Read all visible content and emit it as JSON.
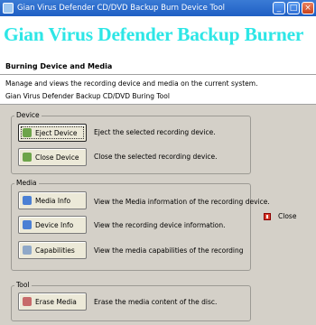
{
  "window": {
    "title": "Gian Virus Defender CD/DVD Backup Burn Device Tool",
    "buttons": {
      "minimize": "_",
      "maximize": "□",
      "close": "×"
    }
  },
  "banner": {
    "title": "Gian Virus Defender Backup Burner"
  },
  "header": {
    "section_title": "Burning Device and Media",
    "description": "Manage and views the recording device and media on the current system.",
    "subdescription": "Gian Virus Defender Backup CD/DVD Buring Tool"
  },
  "groups": {
    "device": {
      "label": "Device",
      "eject": {
        "label": "Eject Device",
        "description": "Eject the selected recording device."
      },
      "close": {
        "label": "Close Device",
        "description": "Close the selected recording device."
      }
    },
    "media": {
      "label": "Media",
      "media_info": {
        "label": "Media Info",
        "description": "View the Media information of the recording device."
      },
      "device_info": {
        "label": "Device Info",
        "description": "View the recording device information."
      },
      "capabilities": {
        "label": "Capabilities",
        "description": "View the media capabilities of the recording"
      }
    },
    "tool": {
      "label": "Tool",
      "erase": {
        "label": "Erase Media",
        "description": "Erase the media content of the disc."
      }
    }
  },
  "side": {
    "close_label": "Close"
  },
  "colors": {
    "banner_text": "#2de6e6",
    "titlebar": "#1f5fc4",
    "close_icon": "#d83a2a"
  },
  "icons": {
    "eject": "eject-icon",
    "close_device": "close-tray-icon",
    "media_info": "info-icon",
    "device_info": "device-icon",
    "capabilities": "capabilities-icon",
    "erase": "erase-icon",
    "close": "close-icon"
  }
}
